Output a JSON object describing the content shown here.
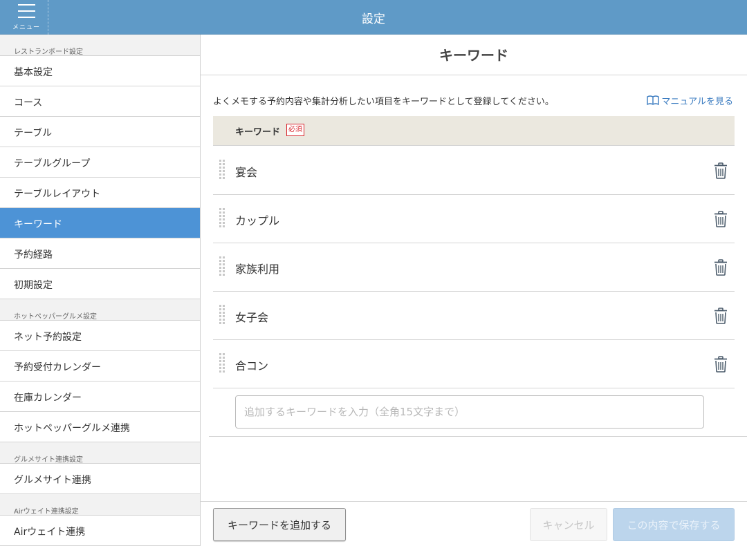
{
  "header": {
    "menu_label": "メニュー",
    "title": "設定"
  },
  "sidebar": {
    "sections": [
      {
        "title": "レストランボード設定",
        "items": [
          {
            "label": "基本設定",
            "active": false
          },
          {
            "label": "コース",
            "active": false
          },
          {
            "label": "テーブル",
            "active": false
          },
          {
            "label": "テーブルグループ",
            "active": false
          },
          {
            "label": "テーブルレイアウト",
            "active": false
          },
          {
            "label": "キーワード",
            "active": true
          },
          {
            "label": "予約経路",
            "active": false
          },
          {
            "label": "初期設定",
            "active": false
          }
        ]
      },
      {
        "title": "ホットペッパーグルメ設定",
        "items": [
          {
            "label": "ネット予約設定",
            "active": false
          },
          {
            "label": "予約受付カレンダー",
            "active": false
          },
          {
            "label": "在庫カレンダー",
            "active": false
          },
          {
            "label": "ホットペッパーグルメ連携",
            "active": false
          }
        ]
      },
      {
        "title": "グルメサイト連携設定",
        "items": [
          {
            "label": "グルメサイト連携",
            "active": false
          }
        ]
      },
      {
        "title": "Airウェイト連携設定",
        "items": [
          {
            "label": "Airウェイト連携",
            "active": false
          }
        ]
      }
    ]
  },
  "main": {
    "title": "キーワード",
    "description": "よくメモする予約内容や集計分析したい項目をキーワードとして登録してください。",
    "manual_link": "マニュアルを見る",
    "table_header": "キーワード",
    "required_badge": "必須",
    "keywords": [
      "宴会",
      "カップル",
      "家族利用",
      "女子会",
      "合コン"
    ],
    "input_placeholder": "追加するキーワードを入力（全角15文字まで）",
    "input_value": ""
  },
  "footer": {
    "add_button": "キーワードを追加する",
    "cancel_button": "キャンセル",
    "save_button": "この内容で保存する"
  },
  "colors": {
    "header_bg": "#5f9ac7",
    "active_item_bg": "#4d93d6",
    "link": "#3a7bc0",
    "required": "#d8232a",
    "table_header_bg": "#ebe8df"
  },
  "icons": {
    "menu": "hamburger-icon",
    "manual": "book-icon",
    "row_drag": "drag-handle-icon",
    "row_delete": "trash-icon"
  }
}
